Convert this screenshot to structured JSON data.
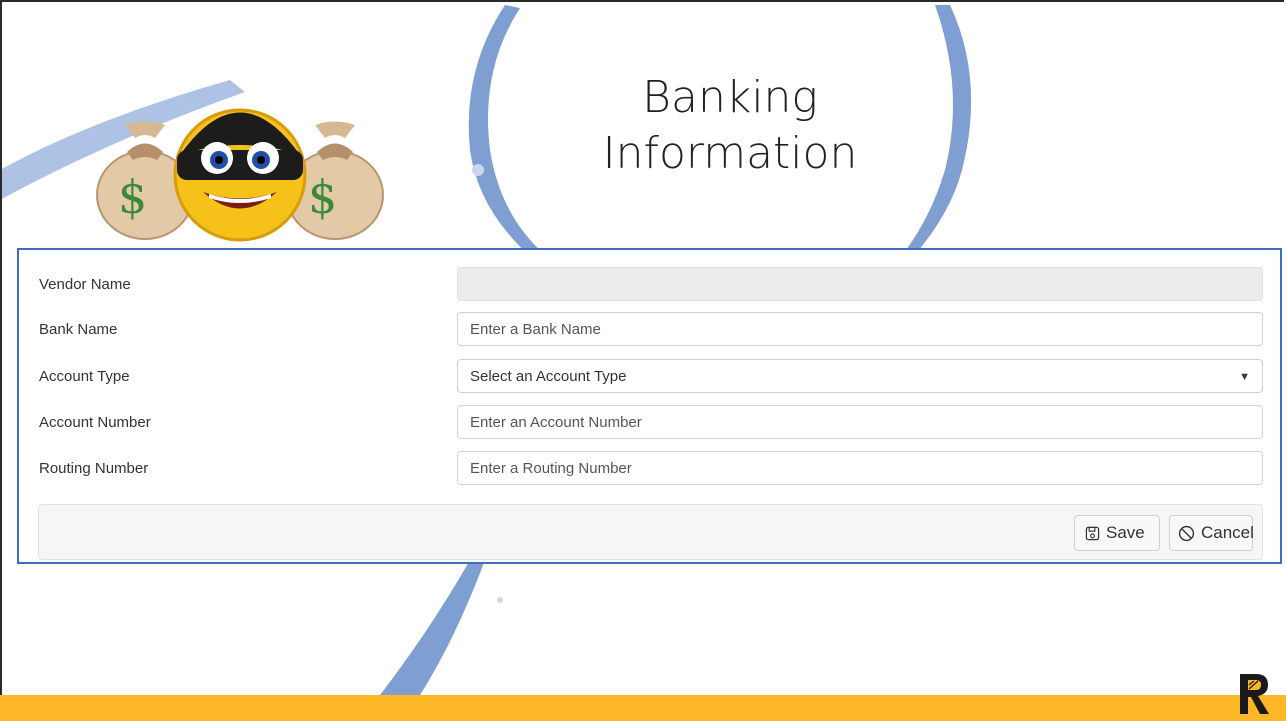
{
  "slide": {
    "title_line1": "Banking",
    "title_line2": "Information"
  },
  "mascot": {
    "description_icon": "robber-emoji-with-money-bags-icon",
    "bag_symbol": "$"
  },
  "form": {
    "vendor_name": {
      "label": "Vendor Name",
      "value": "",
      "placeholder": ""
    },
    "bank_name": {
      "label": "Bank Name",
      "value": "",
      "placeholder": "Enter a Bank Name"
    },
    "account_type": {
      "label": "Account Type",
      "selected": "Select an Account Type"
    },
    "account_number": {
      "label": "Account Number",
      "value": "",
      "placeholder": "Enter an Account Number"
    },
    "routing_number": {
      "label": "Routing Number",
      "value": "",
      "placeholder": "Enter a Routing Number"
    }
  },
  "actions": {
    "save_label": "Save",
    "cancel_label": "Cancel",
    "save_icon": "floppy-disk-icon",
    "cancel_icon": "ban-circle-icon"
  },
  "colors": {
    "panel_border": "#3f6fba",
    "accent_bar": "#fcb626",
    "swoosh": "#7f9ed2"
  }
}
